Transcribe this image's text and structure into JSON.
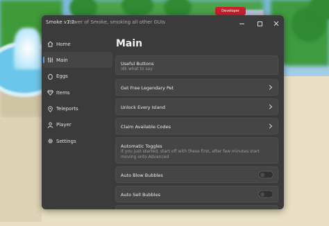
{
  "window": {
    "app_name": "Smoke v1.2",
    "subtitle": "Power of Smoke, smoking all other GUIs"
  },
  "background": {
    "sign_text": "Developer"
  },
  "sidebar": {
    "items": [
      {
        "label": "Home",
        "icon": "home-icon",
        "active": false
      },
      {
        "label": "Main",
        "icon": "sliders-icon",
        "active": true
      },
      {
        "label": "Eggs",
        "icon": "egg-icon",
        "active": false
      },
      {
        "label": "Items",
        "icon": "gem-icon",
        "active": false
      },
      {
        "label": "Teleports",
        "icon": "map-pin-icon",
        "active": false
      },
      {
        "label": "Player",
        "icon": "user-icon",
        "active": false
      },
      {
        "label": "Settings",
        "icon": "gear-icon",
        "active": false
      }
    ]
  },
  "main": {
    "title": "Main",
    "sections": [
      {
        "type": "header",
        "title": "Useful Buttons",
        "desc": "idk what to say"
      },
      {
        "type": "button",
        "title": "Get Free Legendary Pet"
      },
      {
        "type": "button",
        "title": "Unlock Every Island"
      },
      {
        "type": "button",
        "title": "Claim Available Codes"
      },
      {
        "type": "header",
        "title": "Automatic Toggles",
        "desc": "If you just started, start off with these first, after few minutes start moving onto Advanced"
      },
      {
        "type": "toggle",
        "title": "Auto Blow Bubbles",
        "on": false
      },
      {
        "type": "toggle",
        "title": "Auto Sell Bubbles",
        "on": false
      }
    ]
  },
  "colors": {
    "window_bg": "#3b3b3b",
    "card_bg": "#454545",
    "accent": "#5aa0e6"
  }
}
